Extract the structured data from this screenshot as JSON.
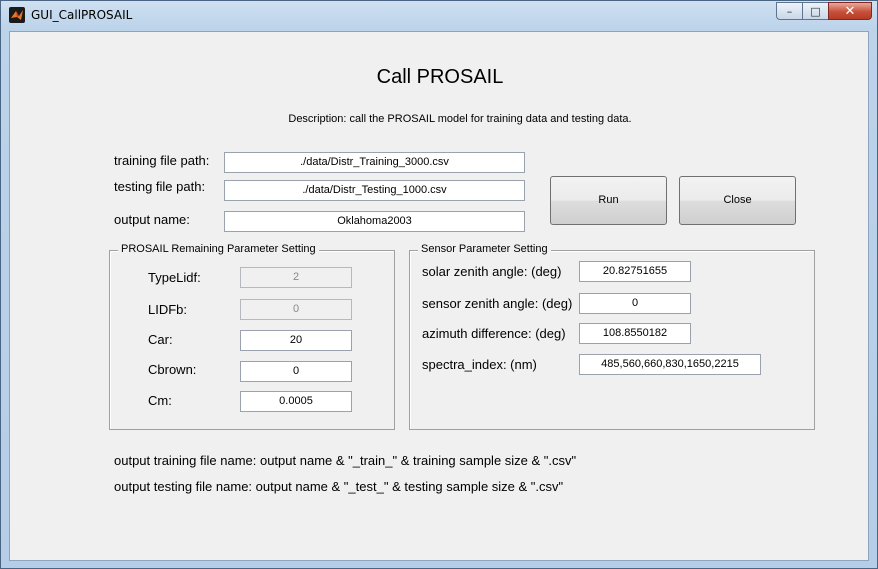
{
  "window": {
    "title": "GUI_CallPROSAIL",
    "minimize_glyph": "–",
    "maximize_glyph": "□",
    "close_glyph": "✕",
    "icon": "matlab-icon"
  },
  "header": {
    "title": "Call PROSAIL",
    "description": "Description: call the PROSAIL model for training data and testing data."
  },
  "files": {
    "training_label": "training file path:",
    "training_value": "./data/Distr_Training_3000.csv",
    "testing_label": "testing file path:",
    "testing_value": "./data/Distr_Testing_1000.csv",
    "output_label": "output name:",
    "output_value": "Oklahoma2003"
  },
  "buttons": {
    "run": "Run",
    "close": "Close"
  },
  "prosail_panel": {
    "title": "PROSAIL Remaining Parameter Setting",
    "params": [
      {
        "label": "TypeLidf:",
        "value": "2",
        "enabled": false
      },
      {
        "label": "LIDFb:",
        "value": "0",
        "enabled": false
      },
      {
        "label": "Car:",
        "value": "20",
        "enabled": true
      },
      {
        "label": "Cbrown:",
        "value": "0",
        "enabled": true
      },
      {
        "label": "Cm:",
        "value": "0.0005",
        "enabled": true
      }
    ]
  },
  "sensor_panel": {
    "title": "Sensor Parameter Setting",
    "params": [
      {
        "label": "solar zenith angle: (deg)",
        "value": "20.82751655"
      },
      {
        "label": "sensor zenith angle: (deg)",
        "value": "0"
      },
      {
        "label": "azimuth difference: (deg)",
        "value": "108.8550182"
      },
      {
        "label": "spectra_index: (nm)",
        "value": "485,560,660,830,1650,2215"
      }
    ]
  },
  "notes": {
    "train": "output training file name: output name & \"_train_\" & training sample size & \".csv\"",
    "test": "output testing file name: output name & \"_test_\" & testing sample size & \".csv\""
  }
}
